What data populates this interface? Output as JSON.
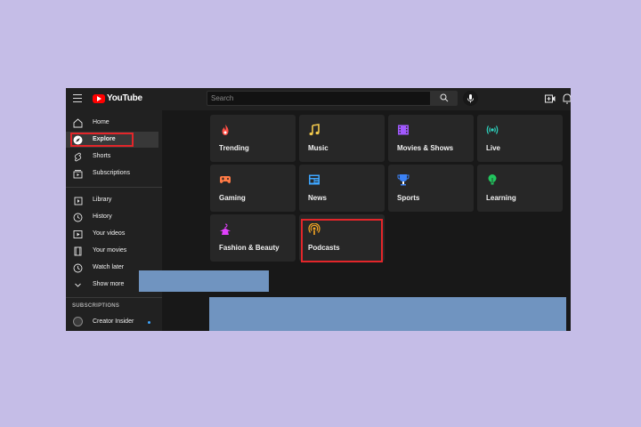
{
  "header": {
    "brand": "YouTube",
    "search_placeholder": "Search"
  },
  "sidebar": {
    "items": [
      {
        "label": "Home",
        "icon": "home-icon"
      },
      {
        "label": "Explore",
        "icon": "compass-icon",
        "active": true
      },
      {
        "label": "Shorts",
        "icon": "shorts-icon"
      },
      {
        "label": "Subscriptions",
        "icon": "subscriptions-icon"
      }
    ],
    "library_items": [
      {
        "label": "Library",
        "icon": "library-icon"
      },
      {
        "label": "History",
        "icon": "history-icon"
      },
      {
        "label": "Your videos",
        "icon": "play-box-icon"
      },
      {
        "label": "Your movies",
        "icon": "film-strip-icon"
      },
      {
        "label": "Watch later",
        "icon": "clock-icon"
      },
      {
        "label": "Show more",
        "icon": "chevron-down-icon"
      }
    ],
    "subscriptions_header": "SUBSCRIPTIONS",
    "subscriptions": [
      {
        "name": "Creator Insider",
        "has_new": true
      }
    ]
  },
  "explore": {
    "tiles": [
      {
        "label": "Trending",
        "icon": "flame-icon",
        "color": "#ff4e45"
      },
      {
        "label": "Music",
        "icon": "music-note-icon",
        "color": "#f2c94c"
      },
      {
        "label": "Movies & Shows",
        "icon": "clapperboard-icon",
        "color": "#a259ff"
      },
      {
        "label": "Live",
        "icon": "broadcast-icon",
        "color": "#2dd4bf"
      },
      {
        "label": "Gaming",
        "icon": "gamepad-icon",
        "color": "#ff7a45"
      },
      {
        "label": "News",
        "icon": "newspaper-icon",
        "color": "#3ea6ff"
      },
      {
        "label": "Sports",
        "icon": "trophy-icon",
        "color": "#3b82f6"
      },
      {
        "label": "Learning",
        "icon": "lightbulb-icon",
        "color": "#22c55e"
      },
      {
        "label": "Fashion & Beauty",
        "icon": "hanger-icon",
        "color": "#e040fb"
      },
      {
        "label": "Podcasts",
        "icon": "podcast-icon",
        "color": "#f5a623",
        "highlighted": true
      }
    ]
  },
  "colors": {
    "highlight_border": "#e3262a",
    "placeholder_block": "#7094c0",
    "page_background": "#c5bde7"
  }
}
